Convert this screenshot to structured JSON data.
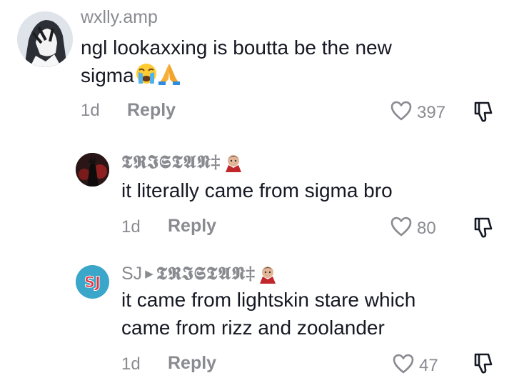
{
  "comments": [
    {
      "username": "wxlly.amp",
      "text_line1": "ngl lookaxxing is boutta be the new",
      "text_line2": "sigma",
      "emojis": [
        "loudly-crying-face",
        "folded-hands"
      ],
      "time": "1d",
      "reply_label": "Reply",
      "likes": "397"
    },
    {
      "username": "𝕿𝕽𝕴𝕾𝕿𝕬𝕹‡",
      "username_emoji": "vampire",
      "text_line1": "it literally came from sigma bro",
      "time": "1d",
      "reply_label": "Reply",
      "likes": "80"
    },
    {
      "username": "SJ",
      "reply_to": "𝕿𝕽𝕴𝕾𝕿𝕬𝕹‡",
      "reply_to_emoji": "vampire",
      "avatar_text": "SJ",
      "avatar_color": "#3aa6c9",
      "text_line1": "it came from lightskin stare which",
      "text_line2": "came from rizz and zoolander",
      "time": "1d",
      "reply_label": "Reply",
      "likes": "47"
    }
  ]
}
